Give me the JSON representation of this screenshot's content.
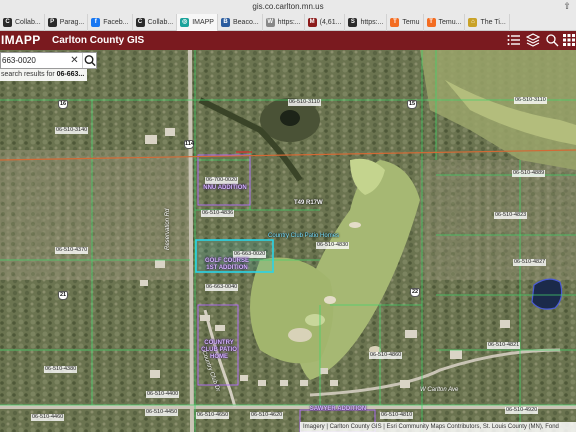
{
  "browser": {
    "url": "gis.co.carlton.mn.us",
    "tabs": [
      {
        "label": "Collab...",
        "icon": "collab-icon",
        "color": "#2b2b2b"
      },
      {
        "label": "Parag...",
        "icon": "para-icon",
        "color": "#2b2b2b"
      },
      {
        "label": "Faceb...",
        "icon": "facebook-icon",
        "color": "#1877f2"
      },
      {
        "label": "Collab...",
        "icon": "collab-icon",
        "color": "#2b2b2b"
      },
      {
        "label": "IMAPP",
        "icon": "imapp-icon",
        "color": "#1aa39b"
      },
      {
        "label": "Beaco...",
        "icon": "beacon-icon",
        "color": "#2b5c9e"
      },
      {
        "label": "https:...",
        "icon": "web-icon",
        "color": "#888888"
      },
      {
        "label": "(4,61...",
        "icon": "mail-icon",
        "color": "#8b1a1a"
      },
      {
        "label": "https:...",
        "icon": "s-icon",
        "color": "#2b2b2b"
      },
      {
        "label": "Temu",
        "icon": "temu-icon",
        "color": "#f36c21"
      },
      {
        "label": "Temu...",
        "icon": "temu-icon",
        "color": "#f36c21"
      },
      {
        "label": "The Ti...",
        "icon": "home-icon",
        "color": "#c9a227"
      }
    ]
  },
  "header": {
    "app_name": "IMAPP",
    "title": "Carlton County GIS",
    "icons": [
      "list-icon",
      "layers-icon",
      "tools-icon",
      "grid-icon"
    ]
  },
  "search": {
    "value": "663-0020",
    "results_prefix": "search results for ",
    "results_term": "06-663..."
  },
  "map": {
    "parcel_labels": [
      "06-510-3110",
      "06-510-3110",
      "06-510-3140",
      "06-510-4889",
      "06-700-0020",
      "06-510-4836",
      "06-510-4823",
      "06-663-0020",
      "06-510-4830",
      "06-510-4370",
      "06-510-4827",
      "06-663-0040",
      "06-510-4821",
      "06-510-4860",
      "06-510-4380",
      "06-510-4450",
      "06-510-4460",
      "06-510-4400",
      "06-510-4650",
      "06-510-4620",
      "06-510-4810",
      "06-510-4920"
    ],
    "subdivisions": [
      "NNU ADDITION",
      "GOLF COURSE 1ST ADDITION",
      "COUNTRY CLUB PATIO HOME",
      "SAWYER ADDITION"
    ],
    "township": "T49 R17W",
    "parcel_note": "Country Club Patio Homes",
    "road_labels": [
      "Reservation Rd",
      "W Carlton Ave",
      "Country Club Dr"
    ],
    "shields": [
      "16",
      "114",
      "15",
      "21",
      "22"
    ],
    "highlight_color": "#2ad4e6",
    "section_line_color": "#d26a35"
  },
  "attribution": "Imagery | Carlton County GIS | Esri Community Maps Contributors, St. Louis County (MN), Fond"
}
